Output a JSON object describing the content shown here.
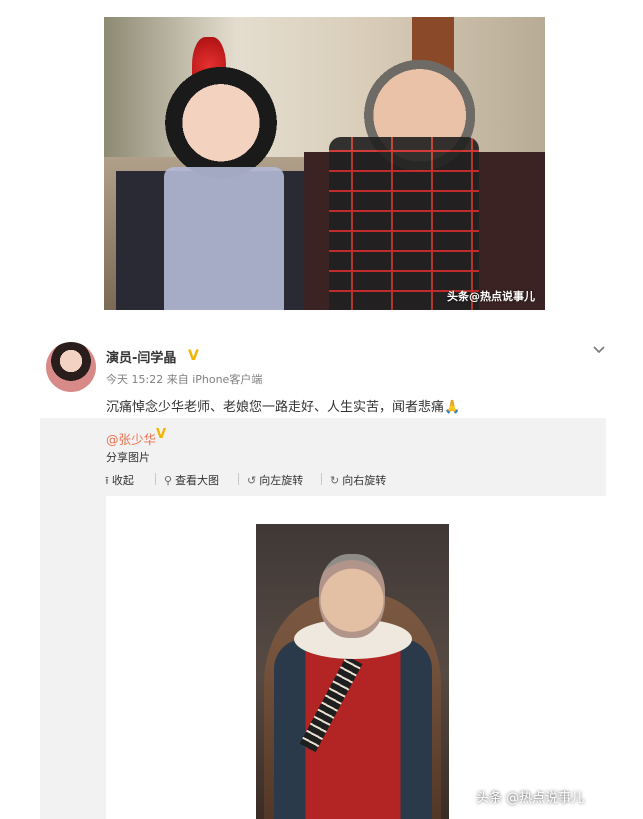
{
  "top_image": {
    "watermark": "头条@热点说事儿"
  },
  "post": {
    "username": "演员-闫学晶",
    "verified_badge": "V",
    "meta": "今天 15:22 来自 iPhone客户端",
    "expand_icon": "chevron-down-icon",
    "text": "沉痛悼念少华老师、老娘您一路走好、人生实苦，闻者悲痛",
    "emoji": "🙏"
  },
  "repost": {
    "author": "@张少华",
    "verified_badge": "V",
    "content": "分享图片",
    "toolbar": {
      "collapse": {
        "icon": "upload-icon",
        "label": "收起"
      },
      "view_large": {
        "icon": "search-icon",
        "label": "查看大图"
      },
      "rotate_left": {
        "icon": "rotate-left-icon",
        "label": "向左旋转"
      },
      "rotate_right": {
        "icon": "rotate-right-icon",
        "label": "向右旋转"
      }
    }
  },
  "bottom_watermark": "头条 @热点说事儿",
  "colors": {
    "link": "#eb7350",
    "badge": "#f3b400",
    "repost_bg": "#f2f2f2"
  }
}
